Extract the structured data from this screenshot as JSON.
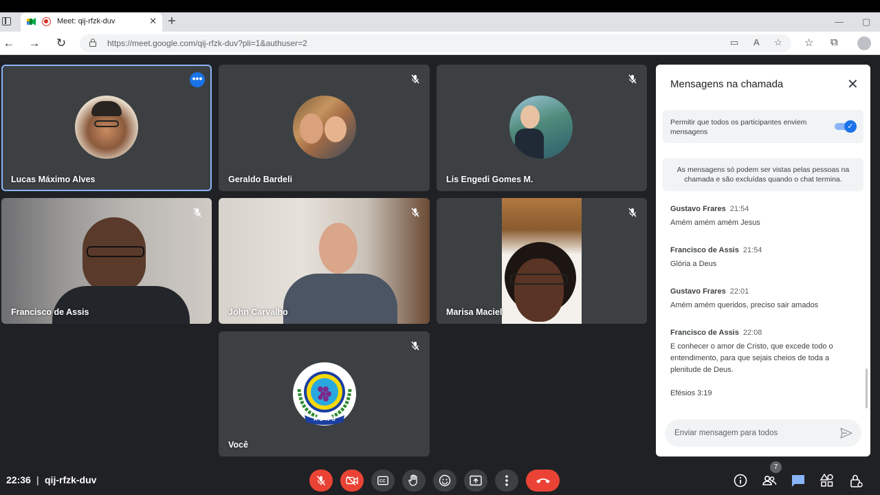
{
  "browser": {
    "tab_title": "Meet: qij-rfzk-duv",
    "url": "https://meet.google.com/qij-rfzk-duv?pli=1&authuser=2"
  },
  "participants": [
    {
      "name": "Lucas Máximo Alves"
    },
    {
      "name": "Geraldo Bardeli"
    },
    {
      "name": "Lis Engedi Gomes M."
    },
    {
      "name": "Francisco de Assis"
    },
    {
      "name": "John Carvalho"
    },
    {
      "name": "Marisa Maciel"
    },
    {
      "name": "Você",
      "logo_text": "ADRS"
    }
  ],
  "chat": {
    "title": "Mensagens na chamada",
    "permission_text": "Permitir que todos os participantes enviem mensagens",
    "permission_enabled": true,
    "info_text": "As mensagens só podem ser vistas pelas pessoas na chamada e são excluídas quando o chat termina.",
    "messages": [
      {
        "sender": "Gustavo Frares",
        "time": "21:54",
        "text": "Amém amém amém Jesus"
      },
      {
        "sender": "Francisco de Assis",
        "time": "21:54",
        "text": "Glória a Deus"
      },
      {
        "sender": "Gustavo Frares",
        "time": "22:01",
        "text": "Amém amém queridos, preciso sair amados"
      },
      {
        "sender": "Francisco de Assis",
        "time": "22:08",
        "text": "E conhecer o amor de Cristo, que excede todo o entendimento, para que sejais cheios de toda a plenitude de Deus.",
        "text2": "Efésios 3:19"
      }
    ],
    "input_placeholder": "Enviar mensagem para todos"
  },
  "footer": {
    "time": "22:36",
    "separator": "|",
    "meeting_code": "qij-rfzk-duv",
    "participant_count": "7"
  },
  "colors": {
    "accent": "#1a73e8",
    "danger": "#ea4335",
    "tile_bg": "#3c4043",
    "page_bg": "#202124"
  }
}
